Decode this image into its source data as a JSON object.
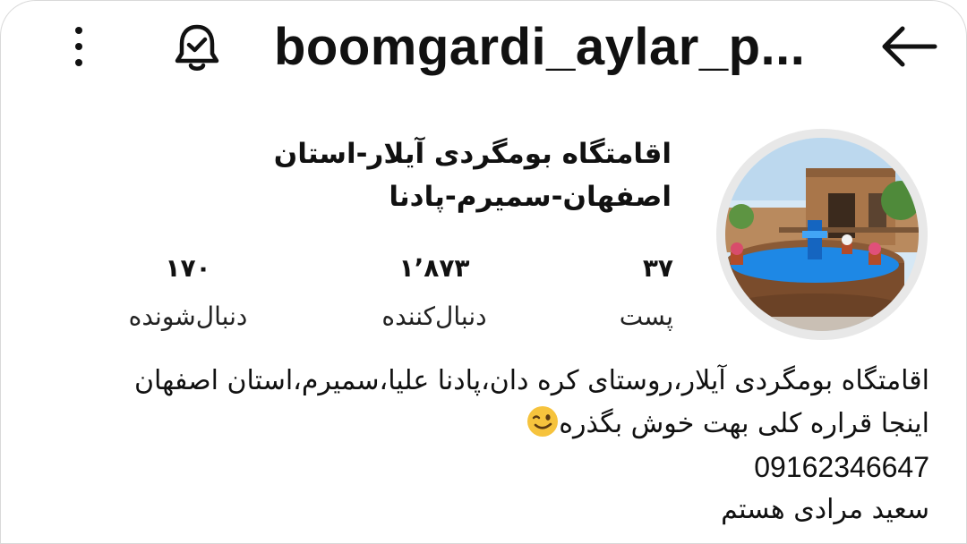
{
  "header": {
    "username": "boomgardi_aylar_p...",
    "icons": [
      "more-vertical-icon",
      "notification-bell-icon",
      "back-arrow-icon"
    ]
  },
  "profile": {
    "display_name_line1": "اقامتگاه بومگردی آیلار-استان",
    "display_name_line2": "اصفهان-سمیرم-پادنا",
    "avatar": "profile-photo"
  },
  "stats": {
    "posts": {
      "count": "۳۷",
      "label": "پست"
    },
    "followers": {
      "count": "۱٬۸۷۳",
      "label": "دنبال‌کننده"
    },
    "following": {
      "count": "۱۷۰",
      "label": "دنبال‌شونده"
    }
  },
  "bio": {
    "line1": "اقامتگاه بومگردی آیلار،روستای کره دان،پادنا علیا،سمیرم،استان اصفهان",
    "line2": "اینجا قراره کلی بهت خوش بگذره",
    "phone": "09162346647",
    "line4": "سعید مرادی هستم",
    "emoji": "winking-face-emoji"
  },
  "colors": {
    "text": "#111111",
    "background": "#ffffff",
    "avatar_ring": "#e8e8e8",
    "pool_blue": "#1e88e5"
  }
}
